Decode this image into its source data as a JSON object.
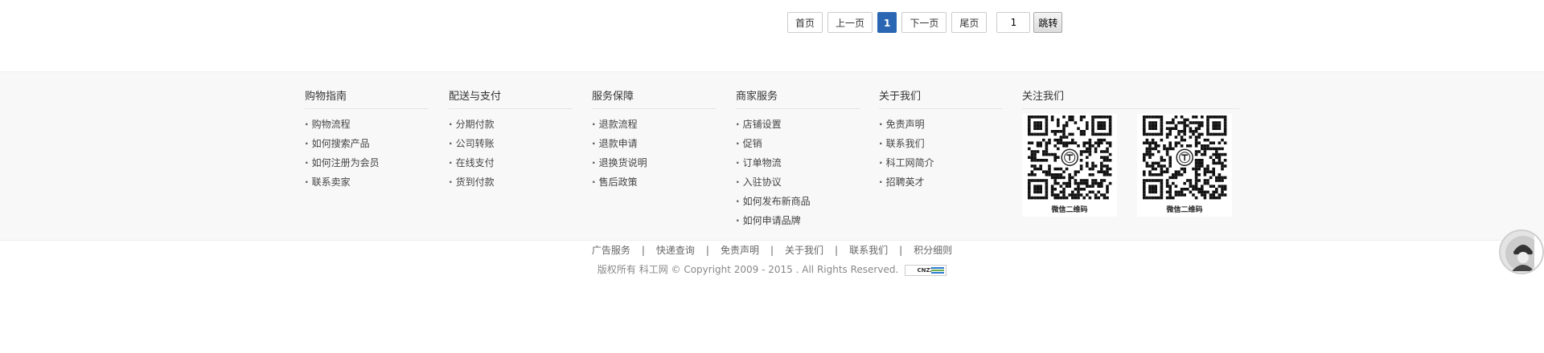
{
  "pagination": {
    "first": "首页",
    "prev": "上一页",
    "current": "1",
    "next": "下一页",
    "last": "尾页",
    "page_input_value": "1",
    "go": "跳转"
  },
  "footer": {
    "columns": [
      {
        "title": "购物指南",
        "items": [
          "购物流程",
          "如何搜索产品",
          "如何注册为会员",
          "联系卖家"
        ]
      },
      {
        "title": "配送与支付",
        "items": [
          "分期付款",
          "公司转账",
          "在线支付",
          "货到付款"
        ]
      },
      {
        "title": "服务保障",
        "items": [
          "退款流程",
          "退款申请",
          "退换货说明",
          "售后政策"
        ]
      },
      {
        "title": "商家服务",
        "items": [
          "店铺设置",
          "促销",
          "订单物流",
          "入驻协议",
          "如何发布新商品",
          "如何申请品牌"
        ]
      },
      {
        "title": "关于我们",
        "items": [
          "免责声明",
          "联系我们",
          "科工网简介",
          "招聘英才"
        ]
      }
    ],
    "follow": {
      "title": "关注我们",
      "qr_codes": [
        {
          "caption": "微信二维码",
          "icon": "qr-code-icon"
        },
        {
          "caption": "微信二维码",
          "icon": "qr-code-icon"
        }
      ]
    }
  },
  "bottom_links": [
    "广告服务",
    "快递查询",
    "免责声明",
    "关于我们",
    "联系我们",
    "积分细则"
  ],
  "separator": "|",
  "copyright": "版权所有 科工网 © Copyright 2009 - 2015 . All Rights Reserved.",
  "cnzz_badge": "CNZZ",
  "colors": {
    "accent": "#2a66b3",
    "footer_bg": "#f8f8f8"
  },
  "float_icon": "avatar-icon"
}
